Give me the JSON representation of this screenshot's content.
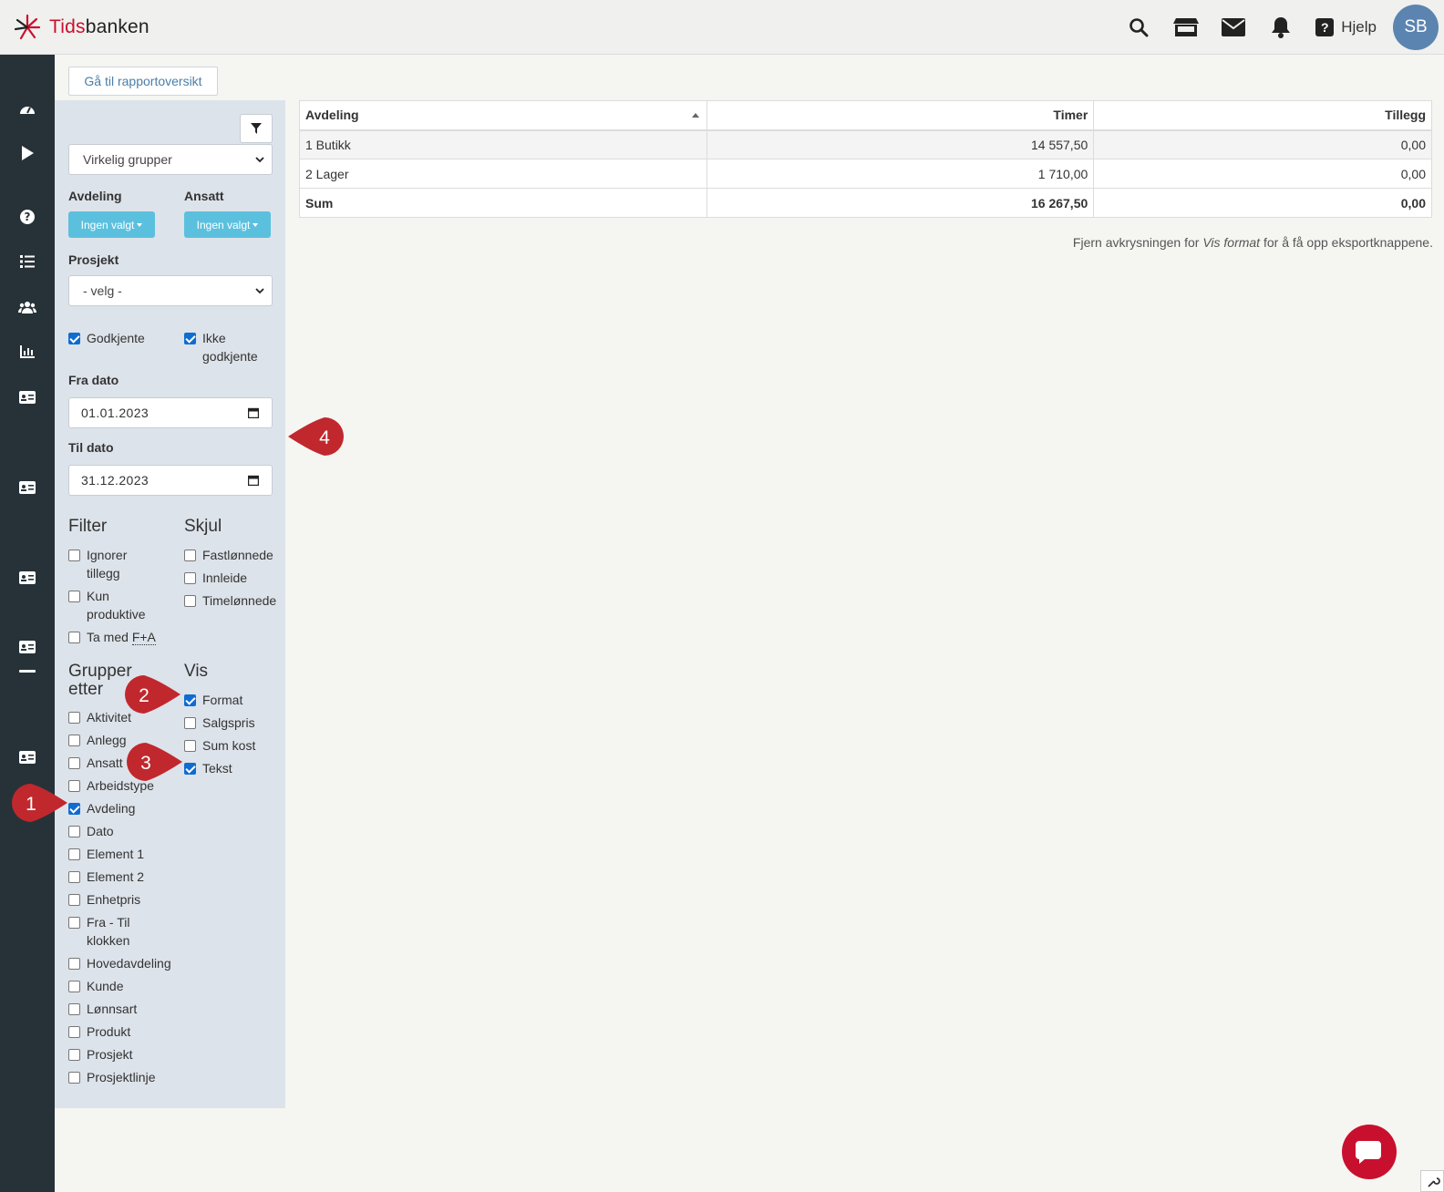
{
  "brand": {
    "name_red": "Tids",
    "name_dark": "banken"
  },
  "topbar": {
    "help_label": "Hjelp",
    "avatar_initials": "SB"
  },
  "goto_report_label": "Gå til rapportoversikt",
  "filter": {
    "group_select": "Virkelig grupper",
    "avdeling_label": "Avdeling",
    "ansatt_label": "Ansatt",
    "avdeling_value": "Ingen valgt",
    "ansatt_value": "Ingen valgt",
    "prosjekt_label": "Prosjekt",
    "prosjekt_value": "- velg -",
    "godkjente": "Godkjente",
    "ikke_godkjente_1": "Ikke",
    "ikke_godkjente_2": "godkjente",
    "fra_dato_label": "Fra dato",
    "fra_dato": "01.01.2023",
    "til_dato_label": "Til dato",
    "til_dato": "31.12.2023",
    "filter_heading": "Filter",
    "skjul_heading": "Skjul",
    "ignorer_1": "Ignorer",
    "ignorer_2": "tillegg",
    "kun_1": "Kun",
    "kun_2": "produktive",
    "ta_med": "Ta med ",
    "fa": "F+A",
    "fastlonnede": "Fastlønnede",
    "innleide": "Innleide",
    "timelonnede": "Timelønnede",
    "grupper_1": "Grupper",
    "grupper_2": "etter",
    "vis_heading": "Vis",
    "vis": [
      "Format",
      "Salgspris",
      "Sum kost",
      "Tekst"
    ],
    "group_items": [
      "Aktivitet",
      "Anlegg",
      "Ansatt",
      "Arbeidstype",
      "Avdeling",
      "Dato",
      "Element 1",
      "Element 2",
      "Enhetpris",
      "Hovedavdeling",
      "Kunde",
      "Lønnsart",
      "Produkt",
      "Prosjekt",
      "Prosjektlinje"
    ],
    "fra_til_1": "Fra - Til",
    "fra_til_2": "klokken"
  },
  "table": {
    "headers": [
      "Avdeling",
      "Timer",
      "Tillegg"
    ],
    "rows": [
      [
        "1 Butikk",
        "14 557,50",
        "0,00"
      ],
      [
        "2 Lager",
        "1 710,00",
        "0,00"
      ],
      [
        "Sum",
        "16 267,50",
        "0,00"
      ]
    ]
  },
  "note": {
    "before": "Fjern avkrysningen for ",
    "em": "Vis format",
    "after": " for å få opp eksportknappene."
  },
  "callouts": [
    "1",
    "2",
    "3",
    "4"
  ],
  "colors": {
    "brand_red": "#c8102e",
    "nav_bg": "#263238",
    "panel_bg": "#dde3ea",
    "pill": "#5bc0de",
    "avatar": "#5b84b0",
    "callout": "#c0282d"
  }
}
